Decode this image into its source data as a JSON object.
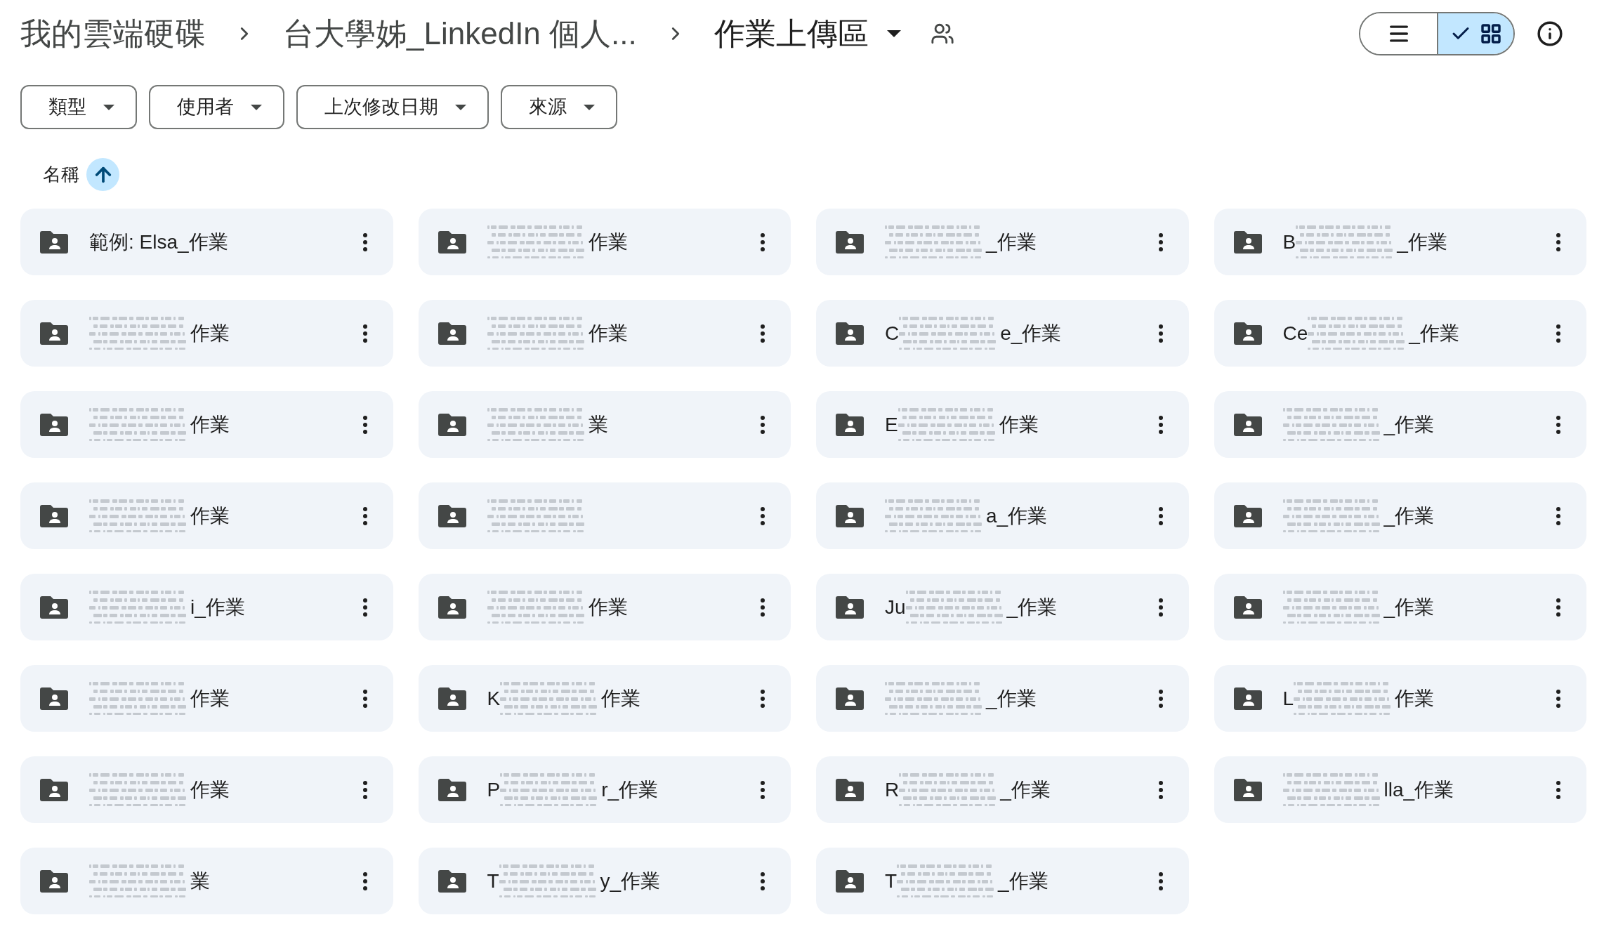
{
  "breadcrumb": [
    {
      "label": "我的雲端硬碟",
      "current": false
    },
    {
      "label": "台大學姊_LinkedIn 個人...",
      "current": false
    },
    {
      "label": "作業上傳區",
      "current": true,
      "shared": true
    }
  ],
  "view_toggle": [
    {
      "kind": "list",
      "selected": false
    },
    {
      "kind": "grid",
      "selected": true
    }
  ],
  "filters": [
    {
      "label": "類型"
    },
    {
      "label": "使用者"
    },
    {
      "label": "上次修改日期"
    },
    {
      "label": "來源"
    }
  ],
  "sort": {
    "label": "名稱",
    "ascending": true
  },
  "folders": [
    {
      "name": "範例: Elsa_作業",
      "redacted": false
    },
    {
      "name": "作業",
      "redacted": true
    },
    {
      "name": "_作業",
      "redacted": true
    },
    {
      "name_start": "B",
      "name": "_作業",
      "redacted": true
    },
    {
      "name": "作業",
      "redacted": true
    },
    {
      "name": "作業",
      "redacted": true
    },
    {
      "name_start": "C",
      "name": "e_作業",
      "redacted": true
    },
    {
      "name_start": "Ce",
      "name": "_作業",
      "redacted": true
    },
    {
      "name": "作業",
      "redacted": true
    },
    {
      "name": "業",
      "redacted": true
    },
    {
      "name_start": "E",
      "name": "作業",
      "redacted": true
    },
    {
      "name": "_作業",
      "redacted": true
    },
    {
      "name": "作業",
      "redacted": true
    },
    {
      "redacted": true
    },
    {
      "name": "a_作業",
      "redacted": true
    },
    {
      "name": "_作業",
      "redacted": true
    },
    {
      "name": "i_作業",
      "redacted": true
    },
    {
      "name": "作業",
      "redacted": true
    },
    {
      "name_start": "Ju",
      "name": "_作業",
      "redacted": true
    },
    {
      "name": "_作業",
      "redacted": true
    },
    {
      "name": "作業",
      "redacted": true
    },
    {
      "name_start": "K",
      "name": "作業",
      "redacted": true
    },
    {
      "name": "_作業",
      "redacted": true
    },
    {
      "name_start": "L",
      "name": "作業",
      "redacted": true
    },
    {
      "name": "作業",
      "redacted": true
    },
    {
      "name_start": "P",
      "name": "r_作業",
      "redacted": true
    },
    {
      "name_start": "R",
      "name": "_作業",
      "redacted": true
    },
    {
      "name": "lla_作業",
      "redacted": true
    },
    {
      "name": "業",
      "redacted": true
    },
    {
      "name_start": "T",
      "name": "y_作業",
      "redacted": true
    },
    {
      "name_start": "T",
      "name": "_作業",
      "redacted": true
    }
  ]
}
